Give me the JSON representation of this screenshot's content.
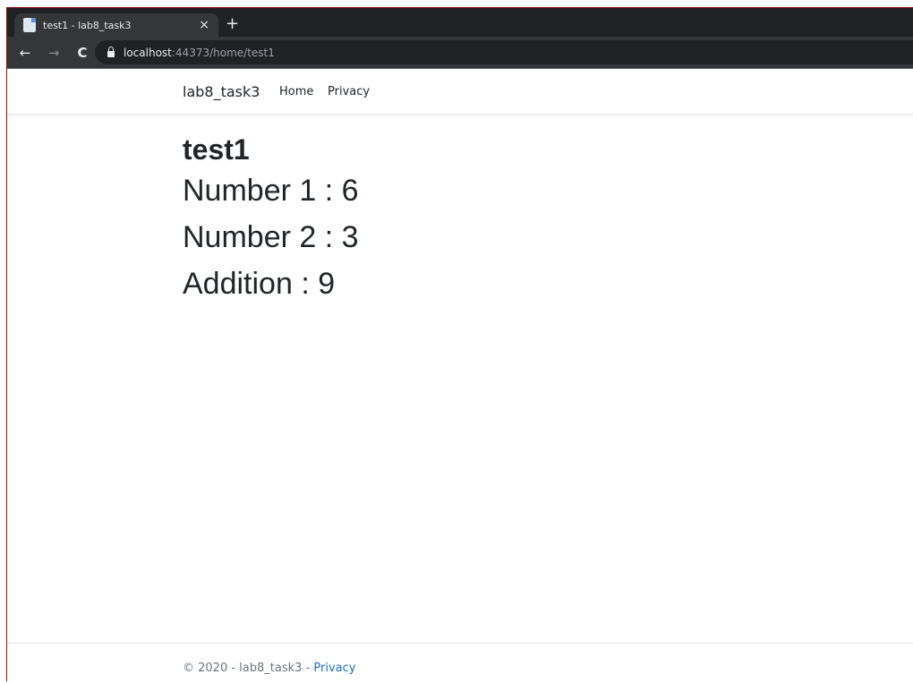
{
  "browser": {
    "tab_title": "test1 - lab8_task3",
    "tab_close": "×",
    "new_tab": "+",
    "back": "←",
    "forward": "→",
    "reload": "C",
    "url_host": "localhost",
    "url_rest": ":44373/home/test1"
  },
  "navbar": {
    "brand": "lab8_task3",
    "links": [
      "Home",
      "Privacy"
    ]
  },
  "main": {
    "title": "test1",
    "number1": "Number 1 : 6",
    "number2": "Number 2 : 3",
    "addition": "Addition : 9"
  },
  "footer": {
    "text": "© 2020 - lab8_task3 - ",
    "link": "Privacy"
  }
}
